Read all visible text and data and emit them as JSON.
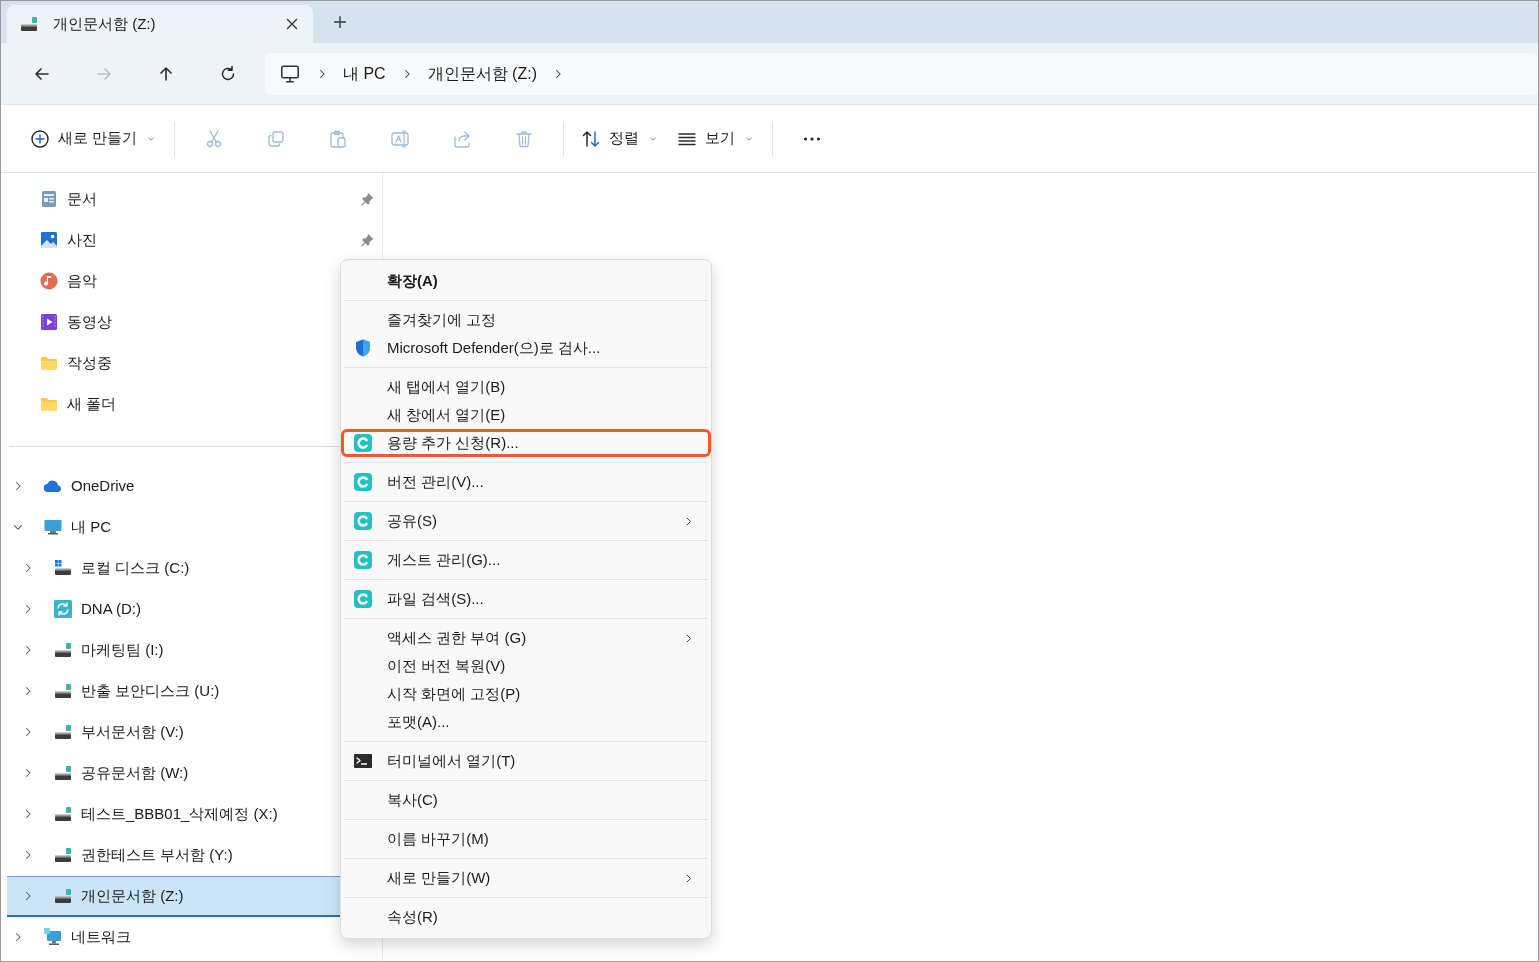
{
  "tab": {
    "title": "개인문서함 (Z:)",
    "selected": true
  },
  "nav_buttons": [
    {
      "kind": "back",
      "disabled": false
    },
    {
      "kind": "forward",
      "disabled": true
    },
    {
      "kind": "up",
      "disabled": false
    },
    {
      "kind": "refresh",
      "disabled": false
    }
  ],
  "breadcrumb": [
    "내 PC",
    "개인문서함 (Z:)"
  ],
  "toolbar": [
    [
      {
        "kind": "new",
        "label": "새로 만들기",
        "dropdown": true,
        "disabled": false
      }
    ],
    [
      {
        "kind": "cut",
        "disabled": true
      },
      {
        "kind": "copy",
        "disabled": true
      },
      {
        "kind": "paste",
        "disabled": true
      },
      {
        "kind": "rename",
        "disabled": true
      },
      {
        "kind": "share",
        "disabled": true
      },
      {
        "kind": "delete",
        "disabled": true
      }
    ],
    [
      {
        "kind": "sort",
        "label": "정렬",
        "dropdown": true,
        "disabled": false
      },
      {
        "kind": "view",
        "label": "보기",
        "dropdown": true,
        "disabled": false
      }
    ],
    [
      {
        "kind": "more",
        "disabled": false
      }
    ]
  ],
  "quick_access": [
    {
      "label": "문서",
      "kind": "documents",
      "pinned": true
    },
    {
      "label": "사진",
      "kind": "pictures",
      "pinned": true
    },
    {
      "label": "음악",
      "kind": "music",
      "pinned": false
    },
    {
      "label": "동영상",
      "kind": "videos",
      "pinned": false
    },
    {
      "label": "작성중",
      "kind": "folder",
      "pinned": false
    },
    {
      "label": "새 폴더",
      "kind": "folder",
      "pinned": false
    }
  ],
  "tree": [
    {
      "label": "OneDrive",
      "kind": "cloud",
      "expanded": false,
      "selected": false
    },
    {
      "label": "내 PC",
      "kind": "pc",
      "expanded": true,
      "selected": false,
      "children": [
        {
          "label": "로컬 디스크 (C:)",
          "kind": "local-disk",
          "expanded": false,
          "selected": false
        },
        {
          "label": "DNA (D:)",
          "kind": "sync-drive",
          "expanded": false,
          "selected": false
        },
        {
          "label": "마케팅팀 (I:)",
          "kind": "network-drive",
          "expanded": false,
          "selected": false
        },
        {
          "label": "반출 보안디스크 (U:)",
          "kind": "network-drive",
          "expanded": false,
          "selected": false
        },
        {
          "label": "부서문서함 (V:)",
          "kind": "network-drive",
          "expanded": false,
          "selected": false
        },
        {
          "label": "공유문서함 (W:)",
          "kind": "network-drive",
          "expanded": false,
          "selected": false
        },
        {
          "label": "테스트_BBB01_삭제예정 (X:)",
          "kind": "network-drive",
          "expanded": false,
          "selected": false
        },
        {
          "label": "권한테스트 부서함 (Y:)",
          "kind": "network-drive",
          "expanded": false,
          "selected": false
        },
        {
          "label": "개인문서함 (Z:)",
          "kind": "network-drive",
          "expanded": false,
          "selected": true
        }
      ]
    },
    {
      "label": "네트워크",
      "kind": "network",
      "expanded": false,
      "selected": false
    }
  ],
  "context_menu": {
    "groups": [
      {
        "items": [
          {
            "label": "확장(A)",
            "bold": true,
            "submenu": false,
            "highlighted": false
          }
        ]
      },
      {
        "items": [
          {
            "label": "즐겨찾기에 고정",
            "submenu": false,
            "highlighted": false
          },
          {
            "label": "Microsoft Defender(으)로 검사...",
            "kind": "shield",
            "submenu": false,
            "highlighted": false
          }
        ]
      },
      {
        "items": [
          {
            "label": "새 탭에서 열기(B)",
            "submenu": false,
            "highlighted": false
          },
          {
            "label": "새 창에서 열기(E)",
            "submenu": false,
            "highlighted": false
          },
          {
            "label": "용량 추가 신청(R)...",
            "kind": "c-logo",
            "submenu": false,
            "highlighted": true
          }
        ]
      },
      {
        "items": [
          {
            "label": "버전 관리(V)...",
            "kind": "c-logo",
            "submenu": false,
            "highlighted": false
          }
        ]
      },
      {
        "items": [
          {
            "label": "공유(S)",
            "kind": "c-logo",
            "submenu": true,
            "highlighted": false
          }
        ]
      },
      {
        "items": [
          {
            "label": "게스트 관리(G)...",
            "kind": "c-logo",
            "submenu": false,
            "highlighted": false
          }
        ]
      },
      {
        "items": [
          {
            "label": "파일 검색(S)...",
            "kind": "c-logo",
            "submenu": false,
            "highlighted": false
          }
        ]
      },
      {
        "items": [
          {
            "label": "액세스 권한 부여 (G)",
            "submenu": true,
            "highlighted": false
          },
          {
            "label": "이전 버전 복원(V)",
            "submenu": false,
            "highlighted": false
          },
          {
            "label": "시작 화면에 고정(P)",
            "submenu": false,
            "highlighted": false
          },
          {
            "label": "포맷(A)...",
            "submenu": false,
            "highlighted": false
          }
        ]
      },
      {
        "items": [
          {
            "label": "터미널에서 열기(T)",
            "kind": "terminal",
            "submenu": false,
            "highlighted": false
          }
        ]
      },
      {
        "items": [
          {
            "label": "복사(C)",
            "submenu": false,
            "highlighted": false
          }
        ]
      },
      {
        "items": [
          {
            "label": "이름 바꾸기(M)",
            "submenu": false,
            "highlighted": false
          }
        ]
      },
      {
        "items": [
          {
            "label": "새로 만들기(W)",
            "submenu": true,
            "highlighted": false
          }
        ]
      },
      {
        "items": [
          {
            "label": "속성(R)",
            "submenu": false,
            "highlighted": false
          }
        ]
      }
    ]
  }
}
